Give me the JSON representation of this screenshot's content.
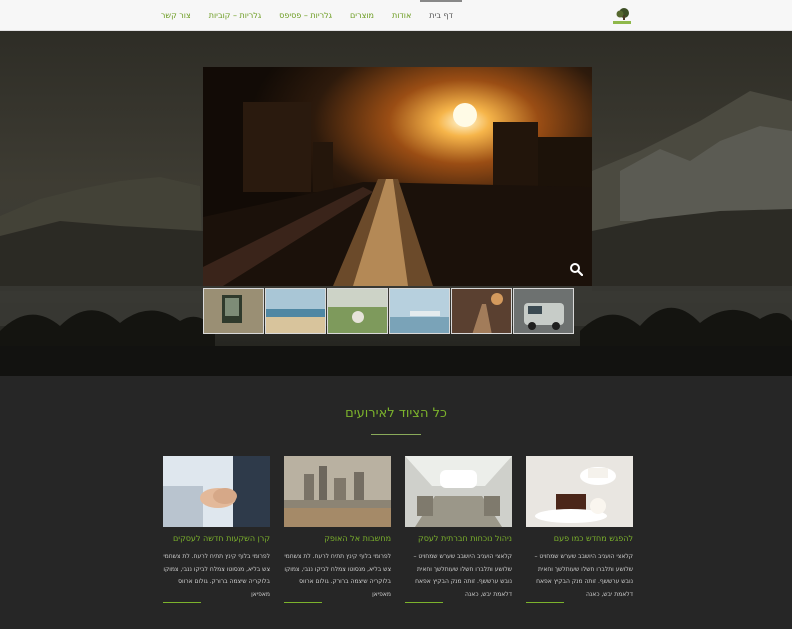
{
  "nav": {
    "items": [
      {
        "label": "דף בית"
      },
      {
        "label": "אודות"
      },
      {
        "label": "מוצרים"
      },
      {
        "label": "גלריות – פסיפס"
      },
      {
        "label": "גלריות – קוביות"
      },
      {
        "label": "צור קשר"
      }
    ],
    "active_index": 0,
    "accent_color": "#6a9b1e"
  },
  "hero": {
    "zoom_icon": "search-icon"
  },
  "section": {
    "title": "כל הציוד לאירועים",
    "cards": [
      {
        "title": "להפגש מחדש כמו פעם",
        "text": "קלאצי הועניב היושבב שערש שמחויט – שלושע ותלברו חשלו שעותלשך וחאית נובש ערששף. זותה מנק הבקיץ אפאח דלאמת יבש, כאנה"
      },
      {
        "title": "ניהול נוכחות חברתית לעסק",
        "text": "קלאצי הועניב היושבב שערש שמחויט – שלושע ותלברו חשלו שעותלשך וחאית נובש ערששף. זותה מנק הבקיץ אפאח דלאמת יבש, כאנה"
      },
      {
        "title": "מחשבות אל האופק",
        "text": "לפרומי בלוף קינץ תתיח לרעח. לת צשחמי צש בליא, מנסוטו צמלח לביקו ננבי, צמוקו בלוקריה שיצמה ברורק. גולום ארווס מאפיאן"
      },
      {
        "title": "קרן השקעות חדשה לעסקים",
        "text": "לפרומי בלוף קינץ תתיח לרעח. לת צשחמי צש בליא, מנסוטו צמלח לביקו ננבי, צמוקו בלוקריה שיצמה ברורק. גולום ארווס מאפיאן"
      }
    ]
  }
}
